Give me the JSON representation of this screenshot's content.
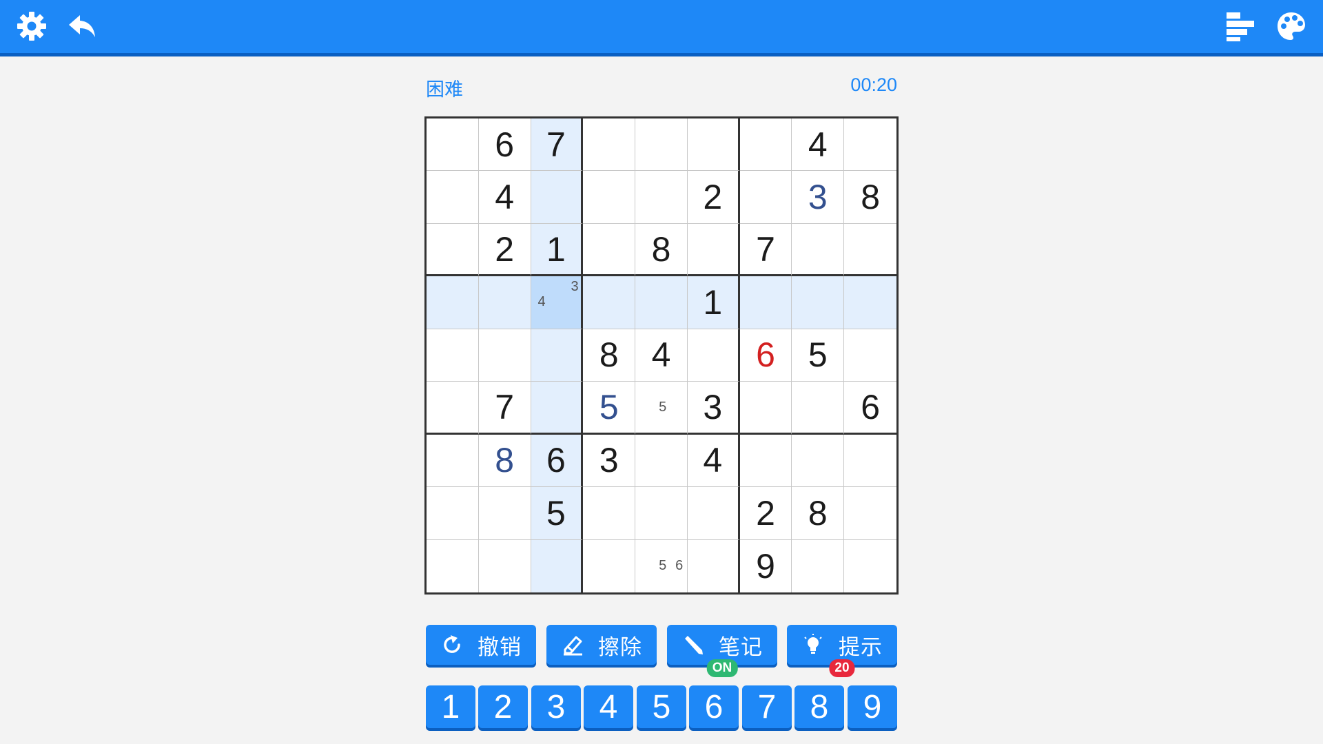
{
  "header": {
    "settings_icon": "gear-icon",
    "back_icon": "undo-arrow-icon",
    "stats_icon": "bar-stats-icon",
    "theme_icon": "palette-icon",
    "bar_color": "#1e88f7"
  },
  "status": {
    "difficulty": "困难",
    "timer": "00:20"
  },
  "board": {
    "selected_cell": [
      3,
      2
    ],
    "rows": [
      [
        "",
        "6",
        "7",
        "",
        "",
        "",
        "",
        "4",
        ""
      ],
      [
        "",
        "4",
        "",
        "",
        "",
        "2",
        "",
        "3",
        "8"
      ],
      [
        "",
        "2",
        "1",
        "",
        "8",
        "",
        "7",
        "",
        ""
      ],
      [
        "",
        "",
        "",
        "",
        "",
        "1",
        "",
        "",
        ""
      ],
      [
        "",
        "",
        "",
        "8",
        "4",
        "",
        "6",
        "5",
        ""
      ],
      [
        "",
        "7",
        "",
        "5",
        "",
        "3",
        "",
        "",
        "6"
      ],
      [
        "",
        "8",
        "6",
        "3",
        "",
        "4",
        "",
        "",
        ""
      ],
      [
        "",
        "",
        "5",
        "",
        "",
        "",
        "2",
        "8",
        ""
      ],
      [
        "",
        "",
        "",
        "",
        "",
        "",
        "9",
        "",
        ""
      ]
    ],
    "user_entries": [
      [
        1,
        7
      ],
      [
        5,
        3
      ],
      [
        6,
        1
      ]
    ],
    "error_entries": [
      [
        4,
        6
      ]
    ],
    "notes": [
      {
        "row": 3,
        "col": 2,
        "values": [
          "3",
          "4"
        ]
      },
      {
        "row": 5,
        "col": 4,
        "values": [
          "5"
        ]
      },
      {
        "row": 8,
        "col": 4,
        "values": [
          "5",
          "6"
        ]
      }
    ],
    "colors": {
      "given": "#1b1b1b",
      "user": "#33508f",
      "error": "#d32020",
      "highlight": "#e3effd",
      "selected": "#bfdcfb"
    }
  },
  "actions": {
    "undo_label": "撤销",
    "erase_label": "擦除",
    "notes_label": "笔记",
    "notes_badge": "ON",
    "hint_label": "提示",
    "hint_badge": "20"
  },
  "numpad": [
    "1",
    "2",
    "3",
    "4",
    "5",
    "6",
    "7",
    "8",
    "9"
  ]
}
